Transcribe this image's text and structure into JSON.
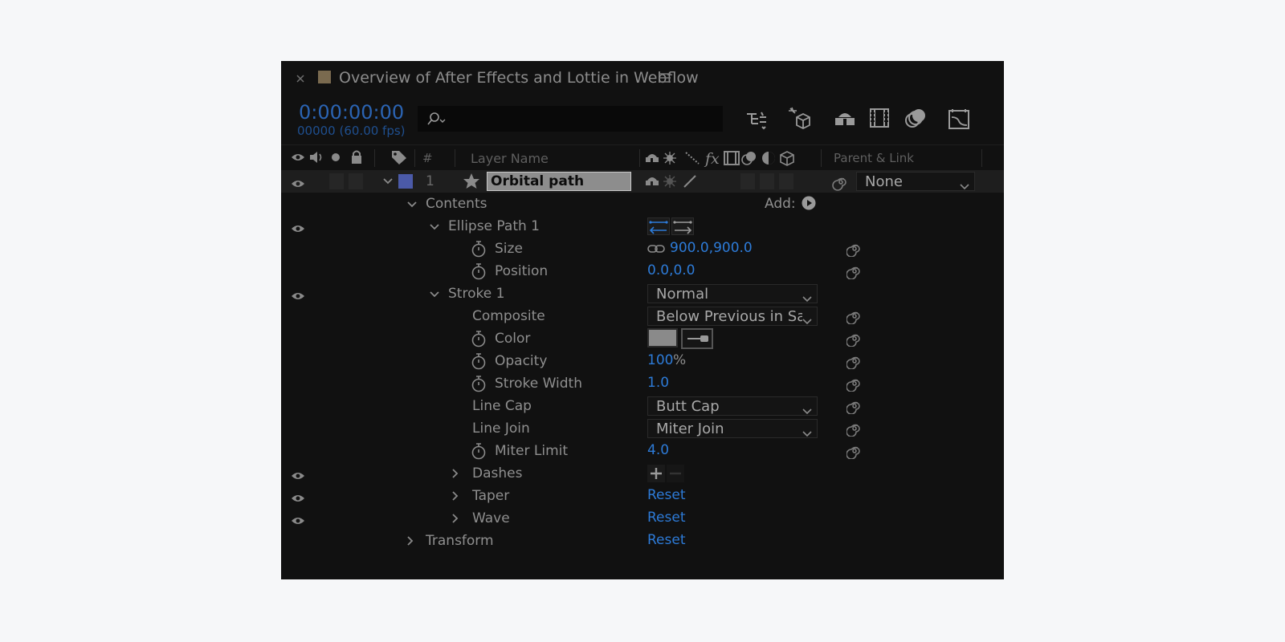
{
  "panel": {
    "title": "Overview of After Effects and Lottie in Webflow",
    "timecode": "0:00:00:00",
    "frame_info": "00000 (60.00 fps)",
    "search_placeholder": "",
    "label_color": "#7a6a4f"
  },
  "columns": {
    "hash": "#",
    "layer_name": "Layer Name",
    "parent_link": "Parent & Link"
  },
  "layer": {
    "number": "1",
    "name": "Orbital path",
    "parent": "None",
    "label_color": "#4b5aa8"
  },
  "tree": {
    "contents": "Contents",
    "add_label": "Add:",
    "ellipse_path": "Ellipse Path 1",
    "size_label": "Size",
    "size_value": "900.0,900.0",
    "position_label": "Position",
    "position_value": "0.0,0.0",
    "stroke": "Stroke 1",
    "stroke_mode": "Normal",
    "composite_label": "Composite",
    "composite_value": "Below Previous in Sa",
    "color_label": "Color",
    "color_value": "#8a8a8a",
    "opacity_label": "Opacity",
    "opacity_value": "100",
    "opacity_unit": "%",
    "stroke_width_label": "Stroke Width",
    "stroke_width_value": "1.0",
    "line_cap_label": "Line Cap",
    "line_cap_value": "Butt Cap",
    "line_join_label": "Line Join",
    "line_join_value": "Miter Join",
    "miter_limit_label": "Miter Limit",
    "miter_limit_value": "4.0",
    "dashes": "Dashes",
    "taper": "Taper",
    "taper_reset": "Reset",
    "wave": "Wave",
    "wave_reset": "Reset",
    "transform": "Transform",
    "transform_reset": "Reset"
  },
  "colors": {
    "accent_blue": "#2d7bd8",
    "panel_bg": "#111111",
    "text_grey": "#8f8f8f"
  }
}
